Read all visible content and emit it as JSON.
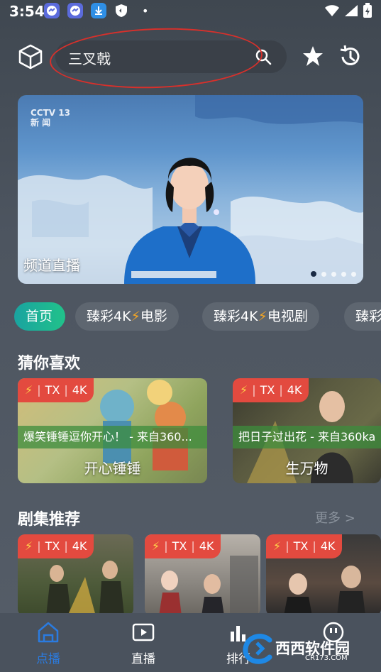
{
  "status_bar": {
    "time": "3:54",
    "apps": [
      "messenger-icon",
      "messenger-icon",
      "download-icon",
      "shield-icon"
    ],
    "right_icons": [
      "wifi-icon",
      "signal-icon",
      "battery-charging-icon"
    ]
  },
  "header": {
    "search_value": "三叉戟",
    "search_icon": "search-icon",
    "favorite_icon": "star-icon",
    "history_icon": "history-icon",
    "logo_icon": "cube-icon",
    "annotation_color": "#d8302b"
  },
  "banner": {
    "logo_line1": "CCTV 13",
    "logo_line2": "新 闻",
    "caption": "频道直播",
    "dots": 5,
    "active_dot": 0
  },
  "tabs": [
    {
      "label": "首页",
      "active": true
    },
    {
      "label": "臻彩4K⚡电影",
      "active": false
    },
    {
      "label": "臻彩4K⚡电视剧",
      "active": false
    },
    {
      "label": "臻彩",
      "active": false
    }
  ],
  "guess_section": {
    "title": "猜你喜欢",
    "cards": [
      {
        "badge_source": "TX",
        "badge_quality": "4K",
        "subtitle": "爆笑锤锤逗你开心！ - 来自360...",
        "title": "开心锤锤"
      },
      {
        "badge_source": "TX",
        "badge_quality": "4K",
        "subtitle": "把日子过出花 - 来自360ka",
        "title": "生万物"
      }
    ]
  },
  "series_section": {
    "title": "剧集推荐",
    "more": "更多 >",
    "cards": [
      {
        "badge_source": "TX",
        "badge_quality": "4K"
      },
      {
        "badge_source": "TX",
        "badge_quality": "4K"
      },
      {
        "badge_source": "TX",
        "badge_quality": "4K"
      }
    ]
  },
  "bottom_nav": [
    {
      "label": "点播",
      "icon": "home-icon",
      "active": true
    },
    {
      "label": "直播",
      "icon": "play-icon",
      "active": false
    },
    {
      "label": "排行",
      "icon": "chart-icon",
      "active": false
    },
    {
      "label": "",
      "icon": "smiley-icon",
      "active": false
    }
  ],
  "watermark": {
    "text": "西西软件园",
    "url": "CR173.COM"
  },
  "colors": {
    "accent_blue": "#2a7be0",
    "badge_red": "#e34a3f",
    "bolt": "#f5a623",
    "tab_active": "#1aa3a0"
  }
}
